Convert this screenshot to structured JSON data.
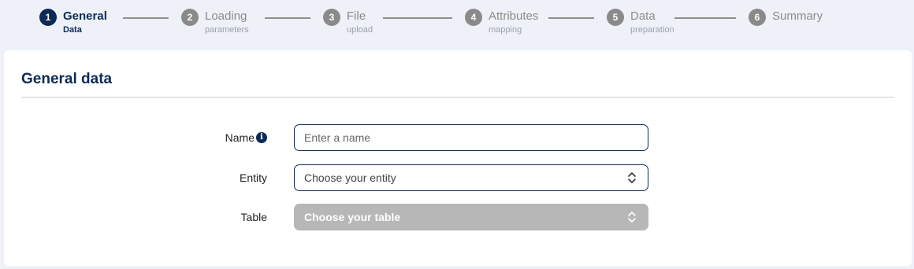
{
  "stepper": {
    "steps": [
      {
        "num": "1",
        "title": "General",
        "sub": "Data",
        "state": "active"
      },
      {
        "num": "2",
        "title": "Loading",
        "sub": "parameters",
        "state": "inactive"
      },
      {
        "num": "3",
        "title": "File",
        "sub": "upload",
        "state": "inactive"
      },
      {
        "num": "4",
        "title": "Attributes",
        "sub": "mapping",
        "state": "inactive"
      },
      {
        "num": "5",
        "title": "Data",
        "sub": "preparation",
        "state": "inactive"
      },
      {
        "num": "6",
        "title": "Summary",
        "sub": "",
        "state": "inactive"
      }
    ]
  },
  "card": {
    "title": "General data"
  },
  "form": {
    "name": {
      "label": "Name",
      "placeholder": "Enter a name",
      "info_icon_glyph": "i"
    },
    "entity": {
      "label": "Entity",
      "value": "Choose your entity"
    },
    "table": {
      "label": "Table",
      "value": "Choose your table",
      "disabled": true
    }
  },
  "icons": {
    "info": "info-circle-icon",
    "select_arrows": "chevron-up-down-icon"
  },
  "colors": {
    "primary": "#0b2a55",
    "background": "#eef2f8",
    "disabled": "#b7b7b7",
    "inactive_step": "#8a8a8a"
  }
}
